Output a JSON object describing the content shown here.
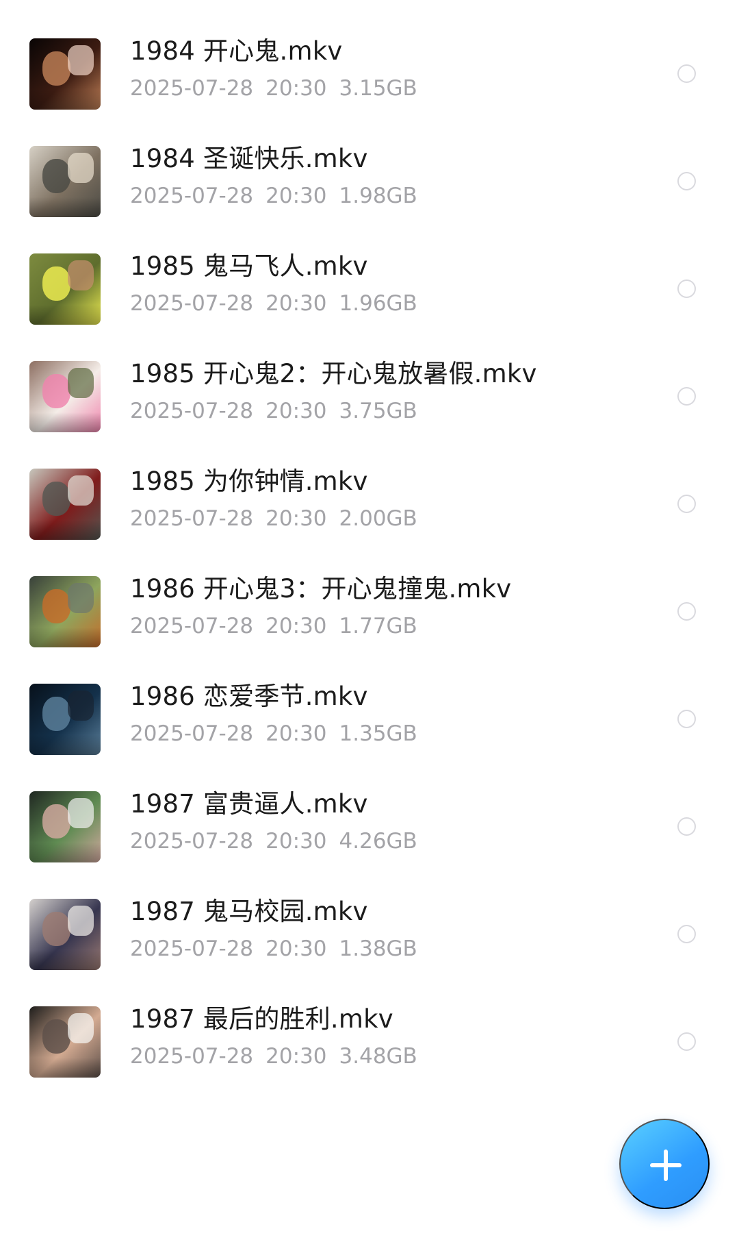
{
  "files": [
    {
      "name": "1984 开心鬼.mkv",
      "date": "2025-07-28",
      "time": "20:30",
      "size": "3.15GB",
      "thumbnail": {
        "icon": "dark-movie-scene-thumbnail",
        "colors": [
          "#090505",
          "#3d1c12",
          "#c08057",
          "#f2d6c8"
        ]
      }
    },
    {
      "name": "1984 圣诞快乐.mkv",
      "date": "2025-07-28",
      "time": "20:30",
      "size": "1.98GB",
      "thumbnail": {
        "icon": "office-scene-thumbnail",
        "colors": [
          "#d6d0c5",
          "#7e7161",
          "#4b4a44",
          "#e9dfce"
        ]
      }
    },
    {
      "name": "1985 鬼马飞人.mkv",
      "date": "2025-07-28",
      "time": "20:30",
      "size": "1.96GB",
      "thumbnail": {
        "icon": "grass-yellow-figure-thumbnail",
        "colors": [
          "#7d8b3f",
          "#5e6d2d",
          "#f0ef52",
          "#c68e6d"
        ]
      }
    },
    {
      "name": "1985 开心鬼2：开心鬼放暑假.mkv",
      "date": "2025-07-28",
      "time": "20:30",
      "size": "3.75GB",
      "thumbnail": {
        "icon": "group-of-students-thumbnail",
        "colors": [
          "#8d6f62",
          "#f4ede8",
          "#ef84ad",
          "#5e6b41"
        ]
      }
    },
    {
      "name": "1985 为你钟情.mkv",
      "date": "2025-07-28",
      "time": "20:30",
      "size": "2.00GB",
      "thumbnail": {
        "icon": "red-crew-car-thumbnail",
        "colors": [
          "#c7c7bd",
          "#7f1b1b",
          "#545752",
          "#e5e2da"
        ]
      }
    },
    {
      "name": "1986 开心鬼3：开心鬼撞鬼.mkv",
      "date": "2025-07-28",
      "time": "20:30",
      "size": "1.77GB",
      "thumbnail": {
        "icon": "green-uniform-person-thumbnail",
        "colors": [
          "#38403a",
          "#8ea55d",
          "#c66c2a",
          "#6d786c"
        ]
      }
    },
    {
      "name": "1986 恋爱季节.mkv",
      "date": "2025-07-28",
      "time": "20:30",
      "size": "1.35GB",
      "thumbnail": {
        "icon": "blue-night-scene-thumbnail",
        "colors": [
          "#07111b",
          "#14314b",
          "#5c809b",
          "#182432"
        ]
      }
    },
    {
      "name": "1987 富贵逼人.mkv",
      "date": "2025-07-28",
      "time": "20:30",
      "size": "4.26GB",
      "thumbnail": {
        "icon": "dinner-party-thumbnail",
        "colors": [
          "#202822",
          "#5f8b52",
          "#d3a9a0",
          "#f2f2f2"
        ]
      }
    },
    {
      "name": "1987 鬼马校园.mkv",
      "date": "2025-07-28",
      "time": "20:30",
      "size": "1.38GB",
      "thumbnail": {
        "icon": "man-in-suit-thumbnail",
        "colors": [
          "#d4d0cd",
          "#36354f",
          "#9c7b73",
          "#f4f1ed"
        ]
      }
    },
    {
      "name": "1987 最后的胜利.mkv",
      "date": "2025-07-28",
      "time": "20:30",
      "size": "3.48GB",
      "thumbnail": {
        "icon": "portrait-man-thumbnail",
        "colors": [
          "#1e1d1b",
          "#d3aa91",
          "#5d4f49",
          "#f8f8f5"
        ]
      }
    }
  ],
  "fab": {
    "icon": "plus-icon",
    "color": "#2f9dff"
  }
}
